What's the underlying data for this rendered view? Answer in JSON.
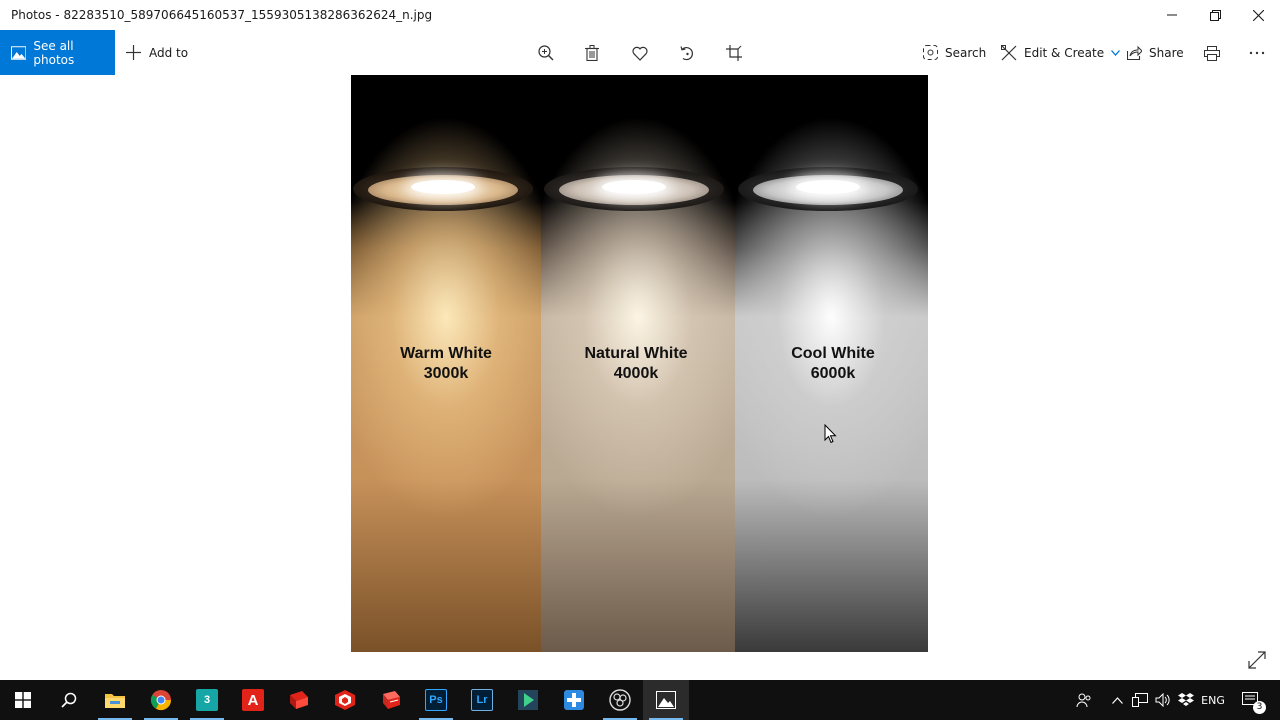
{
  "window": {
    "title": "Photos - 82283510_589706645160537_1559305138286362624_n.jpg"
  },
  "toolbar": {
    "see_all_photos": "See all photos",
    "add_to": "Add to",
    "search": "Search",
    "edit_create": "Edit & Create",
    "share": "Share",
    "accent_color": "#0078d7"
  },
  "photo": {
    "beams": [
      {
        "name": "Warm White",
        "temp": "3000k"
      },
      {
        "name": "Natural White",
        "temp": "4000k"
      },
      {
        "name": "Cool White",
        "temp": "6000k"
      }
    ]
  },
  "taskbar": {
    "apps": [
      "start-icon",
      "search-icon",
      "file-explorer-icon",
      "chrome-icon",
      "3ds-max-icon",
      "autocad-icon",
      "autocad-alt-icon",
      "sketchup-icon",
      "sketchup-alt-icon",
      "photoshop-icon",
      "lightroom-icon",
      "app-icon",
      "app-plus-icon",
      "obs-icon",
      "photos-icon"
    ],
    "photoshop_label": "Ps",
    "lightroom_label": "Lr",
    "max_label": "3",
    "autocad_label": "A",
    "language": "ENG",
    "notification_count": "3"
  }
}
